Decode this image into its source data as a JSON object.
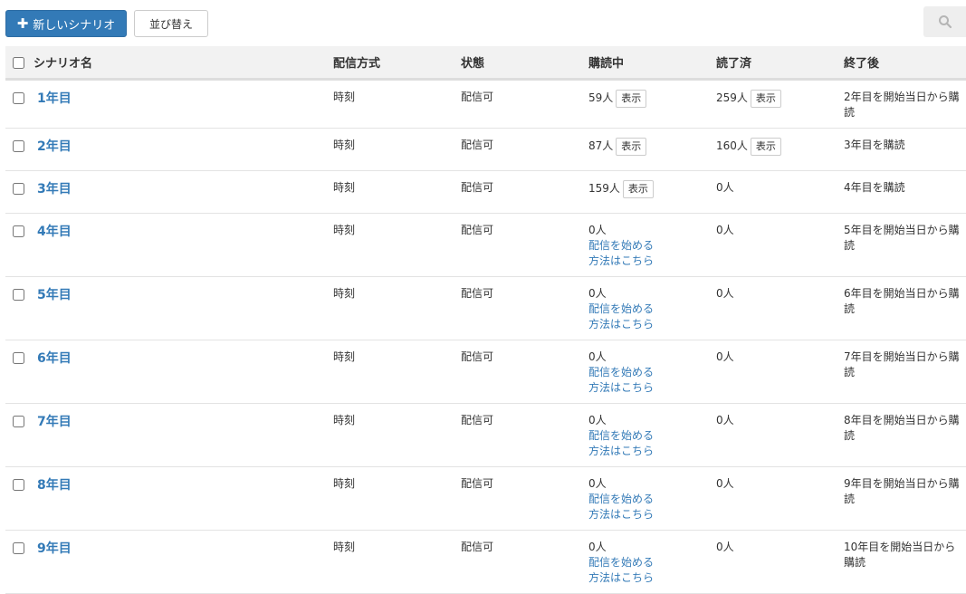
{
  "toolbar": {
    "new_label": "新しいシナリオ",
    "sort_label": "並び替え"
  },
  "columns": [
    "シナリオ名",
    "配信方式",
    "状態",
    "購読中",
    "読了済",
    "終了後"
  ],
  "colors": {
    "accent": "#337ab7",
    "header_bg": "#f2f2f2"
  },
  "rows": [
    {
      "name": "1年目",
      "method": "時刻",
      "status": "配信可",
      "subscribing": "59人",
      "subscribing_show": "表示",
      "read": "259人",
      "read_show": "表示",
      "after": "2年目を開始当日から購読"
    },
    {
      "name": "2年目",
      "method": "時刻",
      "status": "配信可",
      "subscribing": "87人",
      "subscribing_show": "表示",
      "read": "160人",
      "read_show": "表示",
      "after": "3年目を購読"
    },
    {
      "name": "3年目",
      "method": "時刻",
      "status": "配信可",
      "subscribing": "159人",
      "subscribing_show": "表示",
      "read": "0人",
      "after": "4年目を購読"
    },
    {
      "name": "4年目",
      "method": "時刻",
      "status": "配信可",
      "subscribing": "0人",
      "start_link": "配信を始める",
      "howto_link": "方法はこちら",
      "read": "0人",
      "after": "5年目を開始当日から購読"
    },
    {
      "name": "5年目",
      "method": "時刻",
      "status": "配信可",
      "subscribing": "0人",
      "start_link": "配信を始める",
      "howto_link": "方法はこちら",
      "read": "0人",
      "after": "6年目を開始当日から購読"
    },
    {
      "name": "6年目",
      "method": "時刻",
      "status": "配信可",
      "subscribing": "0人",
      "start_link": "配信を始める",
      "howto_link": "方法はこちら",
      "read": "0人",
      "after": "7年目を開始当日から購読"
    },
    {
      "name": "7年目",
      "method": "時刻",
      "status": "配信可",
      "subscribing": "0人",
      "start_link": "配信を始める",
      "howto_link": "方法はこちら",
      "read": "0人",
      "after": "8年目を開始当日から購読"
    },
    {
      "name": "8年目",
      "method": "時刻",
      "status": "配信可",
      "subscribing": "0人",
      "start_link": "配信を始める",
      "howto_link": "方法はこちら",
      "read": "0人",
      "after": "9年目を開始当日から購読"
    },
    {
      "name": "9年目",
      "method": "時刻",
      "status": "配信可",
      "subscribing": "0人",
      "start_link": "配信を始める",
      "howto_link": "方法はこちら",
      "read": "0人",
      "after": "10年目を開始当日から購読"
    }
  ]
}
